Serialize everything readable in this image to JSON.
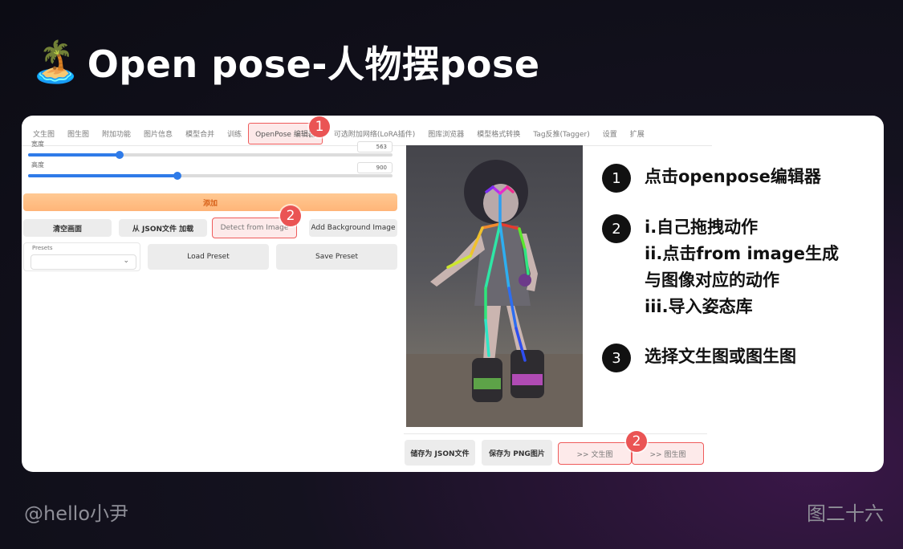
{
  "slide": {
    "title_icon": "palm-island-icon",
    "title_text": "Open pose-人物摆pose",
    "footer_author": "@hello小尹",
    "footer_figure": "图二十六"
  },
  "webui": {
    "tabs": [
      {
        "label": "文生图"
      },
      {
        "label": "图生图"
      },
      {
        "label": "附加功能"
      },
      {
        "label": "图片信息"
      },
      {
        "label": "模型合并"
      },
      {
        "label": "训练"
      },
      {
        "label": "OpenPose 编辑器",
        "active": true
      },
      {
        "label": "可选附加网络(LoRA插件)"
      },
      {
        "label": "图库浏览器"
      },
      {
        "label": "模型格式转换"
      },
      {
        "label": "Tag反推(Tagger)"
      },
      {
        "label": "设置"
      },
      {
        "label": "扩展"
      }
    ],
    "width_slider": {
      "label": "宽度",
      "value": "563",
      "fraction": 0.25
    },
    "height_slider": {
      "label": "高度",
      "value": "900",
      "fraction": 0.41
    },
    "add_button": "添加",
    "clear_button": "清空画面",
    "load_json_button": "从 JSON文件 加载",
    "detect_button": "Detect from Image",
    "add_bg_button": "Add Background Image",
    "presets_label": "Presets",
    "presets_value": "",
    "load_preset_button": "Load Preset",
    "save_preset_button": "Save Preset",
    "save_json_button": "储存为 JSON文件",
    "save_png_button": "保存为 PNG图片",
    "send_txt2img_button": ">> 文生图",
    "send_img2img_button": ">> 图生图"
  },
  "markers": [
    "1",
    "2",
    "2"
  ],
  "steps": [
    {
      "num": "1",
      "lines": [
        "点击openpose编辑器"
      ]
    },
    {
      "num": "2",
      "lines": [
        "i.自己拖拽动作",
        "ii.点击from image生成",
        "与图像对应的动作",
        "iii.导入姿态库"
      ]
    },
    {
      "num": "3",
      "lines": [
        "选择文生图或图生图"
      ]
    }
  ],
  "colors": {
    "accent_red": "#ea5454",
    "add_button_orange": "#ffb578",
    "slider_blue": "#2f7be8"
  }
}
